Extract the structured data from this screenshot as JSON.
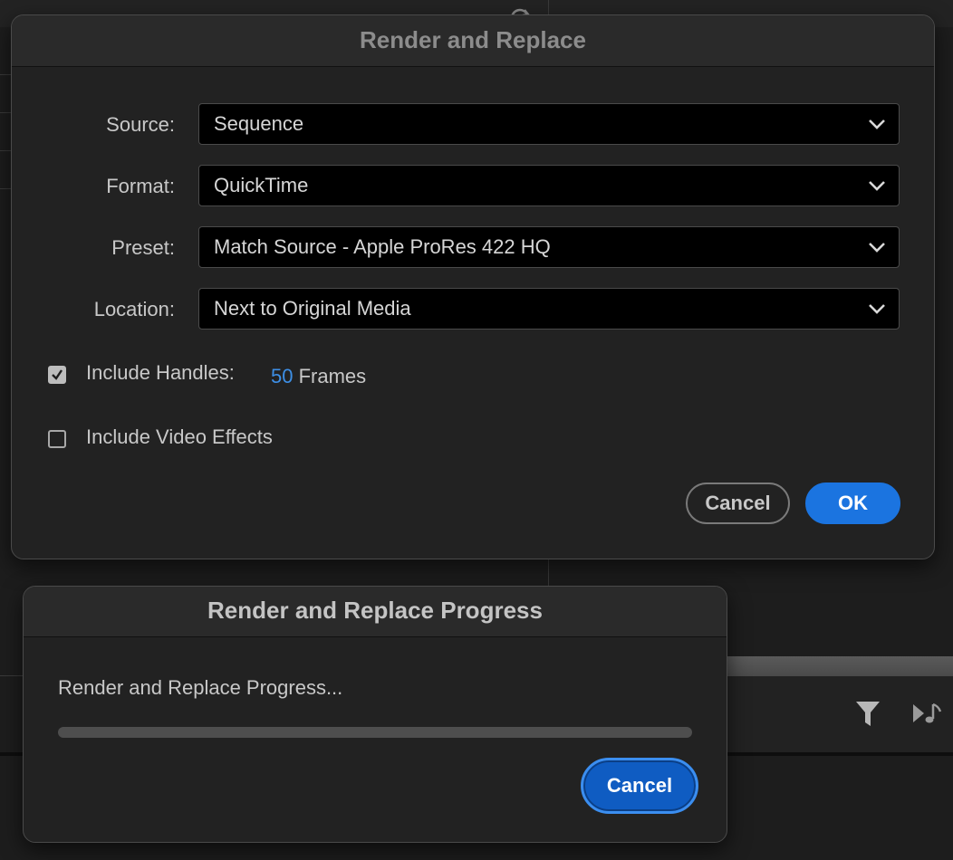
{
  "main_dialog": {
    "title": "Render and Replace",
    "fields": [
      {
        "label": "Source:",
        "value": "Sequence"
      },
      {
        "label": "Format:",
        "value": "QuickTime"
      },
      {
        "label": "Preset:",
        "value": "Match Source - Apple ProRes 422 HQ"
      },
      {
        "label": "Location:",
        "value": "Next to Original Media"
      }
    ],
    "include_handles": {
      "label": "Include Handles:",
      "checked": true,
      "frames_value": "50",
      "frames_unit": "Frames"
    },
    "include_video_effects": {
      "label": "Include Video Effects",
      "checked": false
    },
    "cancel_label": "Cancel",
    "ok_label": "OK",
    "accent_color": "#1b74e0",
    "link_color": "#3d8fe6"
  },
  "progress_dialog": {
    "title": "Render and Replace Progress",
    "message": "Render and Replace Progress...",
    "progress": 0,
    "cancel_label": "Cancel"
  },
  "background_icons": [
    "sync-icon",
    "filter-funnel-icon",
    "music-note-icon"
  ]
}
